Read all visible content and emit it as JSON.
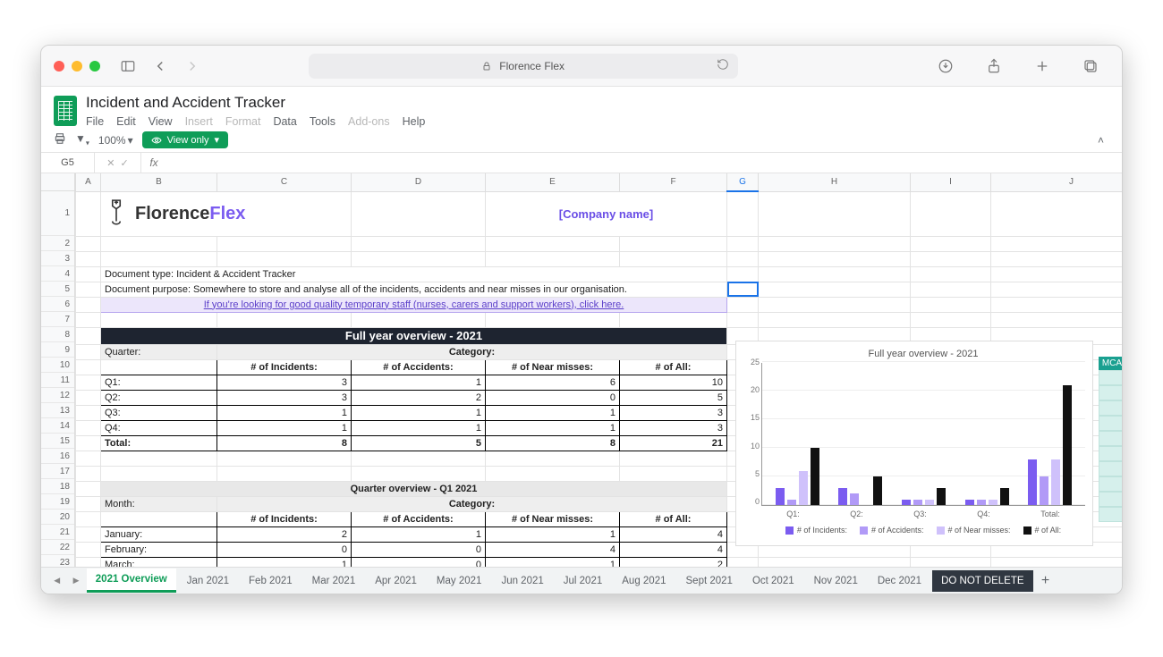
{
  "browser": {
    "address_label": "Florence Flex"
  },
  "doc": {
    "title": "Incident and Accident Tracker",
    "menu": [
      "File",
      "Edit",
      "View",
      "Insert",
      "Format",
      "Data",
      "Tools",
      "Add-ons",
      "Help"
    ],
    "zoom": "100%",
    "view_mode": "View only",
    "cell_ref": "G5"
  },
  "cols": [
    "A",
    "B",
    "C",
    "D",
    "E",
    "F",
    "G",
    "H",
    "I",
    "J"
  ],
  "logo_text_a": "Florence",
  "logo_text_b": "Flex",
  "company_placeholder": "[Company name]",
  "doc_type": "Document type: Incident & Accident Tracker",
  "doc_purpose": "Document purpose: Somewhere to store and analyse all of the incidents, accidents and near misses in our organisation.",
  "promo_link": "If you're looking for good quality temporary staff (nurses, carers and support workers), click here.",
  "full_year": {
    "title": "Full year overview - 2021",
    "row_label": "Quarter:",
    "cat_label": "Category:",
    "headers": [
      "# of Incidents:",
      "# of Accidents:",
      "# of Near misses:",
      "# of All:"
    ],
    "rows": [
      {
        "label": "Q1:",
        "v": [
          3,
          1,
          6,
          10
        ]
      },
      {
        "label": "Q2:",
        "v": [
          3,
          2,
          0,
          5
        ]
      },
      {
        "label": "Q3:",
        "v": [
          1,
          1,
          1,
          3
        ]
      },
      {
        "label": "Q4:",
        "v": [
          1,
          1,
          1,
          3
        ]
      }
    ],
    "total": {
      "label": "Total:",
      "v": [
        8,
        5,
        8,
        21
      ]
    }
  },
  "q1": {
    "title": "Quarter overview - Q1 2021",
    "row_label": "Month:",
    "cat_label": "Category:",
    "headers": [
      "# of Incidents:",
      "# of Accidents:",
      "# of Near misses:",
      "# of All:"
    ],
    "rows": [
      {
        "label": "January:",
        "v": [
          2,
          1,
          1,
          4
        ]
      },
      {
        "label": "February:",
        "v": [
          0,
          0,
          4,
          4
        ]
      },
      {
        "label": "March:",
        "v": [
          1,
          0,
          1,
          2
        ]
      }
    ]
  },
  "chart_data": {
    "type": "bar",
    "title": "Full year overview - 2021",
    "categories": [
      "Q1:",
      "Q2:",
      "Q3:",
      "Q4:",
      "Total:"
    ],
    "series": [
      {
        "name": "# of Incidents:",
        "values": [
          3,
          3,
          1,
          1,
          8
        ]
      },
      {
        "name": "# of Accidents:",
        "values": [
          1,
          2,
          1,
          1,
          5
        ]
      },
      {
        "name": "# of Near misses:",
        "values": [
          6,
          0,
          1,
          1,
          8
        ]
      },
      {
        "name": "# of All:",
        "values": [
          10,
          5,
          3,
          3,
          21
        ]
      }
    ],
    "ylim": [
      0,
      25
    ],
    "yticks": [
      0,
      5,
      10,
      15,
      20,
      25
    ]
  },
  "side_label": "MCA",
  "tabs": [
    "2021 Overview",
    "Jan 2021",
    "Feb 2021",
    "Mar 2021",
    "Apr 2021",
    "May 2021",
    "Jun 2021",
    "Jul 2021",
    "Aug 2021",
    "Sept 2021",
    "Oct 2021",
    "Nov 2021",
    "Dec 2021",
    "DO NOT DELETE"
  ]
}
